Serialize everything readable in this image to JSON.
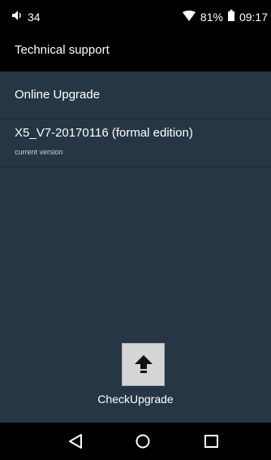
{
  "status_bar": {
    "volume_level": "34",
    "battery_percent": "81%",
    "time": "09:17",
    "icons": [
      "volume-icon",
      "wifi-icon",
      "battery-icon"
    ]
  },
  "app_bar": {
    "title": "Technical support"
  },
  "list": {
    "online_upgrade_label": "Online Upgrade",
    "version_title": "X5_V7-20170116 (formal edition)",
    "version_subtitle": "current version"
  },
  "upgrade": {
    "icon": "upload-arrow-icon",
    "label": "CheckUpgrade"
  },
  "nav_bar": {
    "icons": [
      "back-icon",
      "home-icon",
      "recents-icon"
    ]
  },
  "colors": {
    "background": "#263644",
    "bars": "#000000",
    "button": "#d3d5d7",
    "text": "#ffffff"
  }
}
